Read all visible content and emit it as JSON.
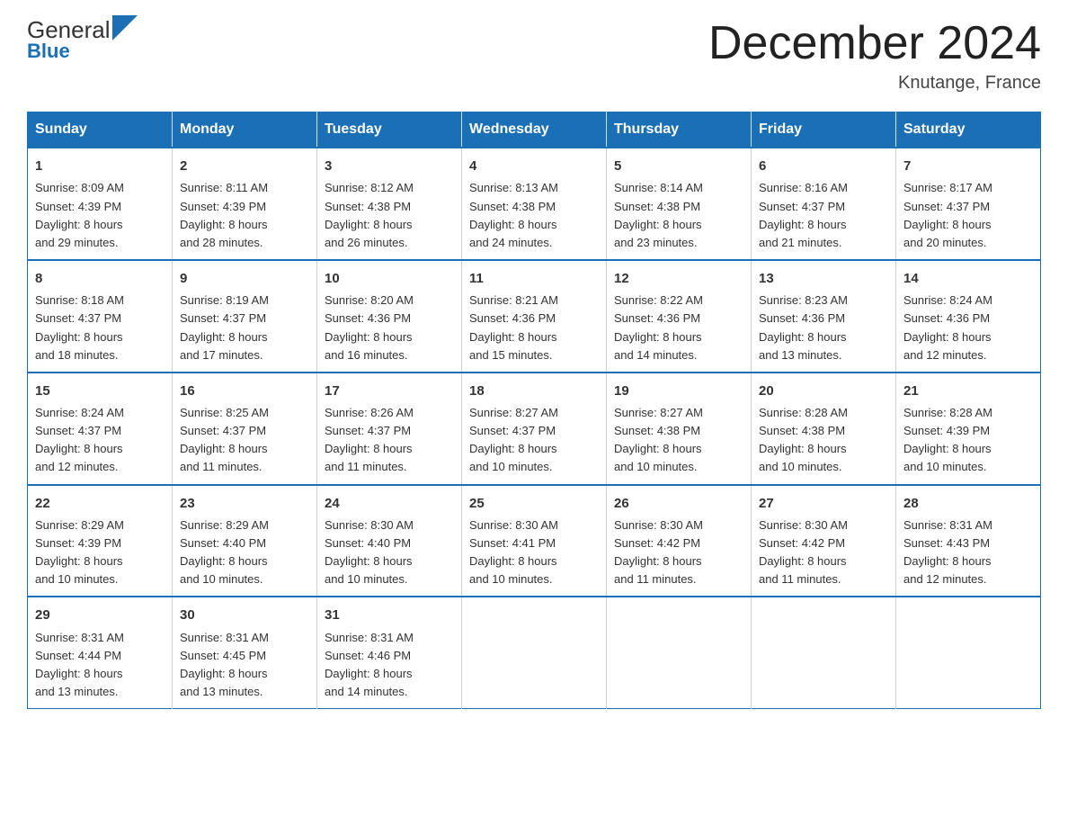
{
  "header": {
    "logo_general": "General",
    "logo_blue": "Blue",
    "month_title": "December 2024",
    "location": "Knutange, France"
  },
  "weekdays": [
    "Sunday",
    "Monday",
    "Tuesday",
    "Wednesday",
    "Thursday",
    "Friday",
    "Saturday"
  ],
  "weeks": [
    [
      {
        "day": "1",
        "sunrise": "8:09 AM",
        "sunset": "4:39 PM",
        "daylight": "8 hours and 29 minutes."
      },
      {
        "day": "2",
        "sunrise": "8:11 AM",
        "sunset": "4:39 PM",
        "daylight": "8 hours and 28 minutes."
      },
      {
        "day": "3",
        "sunrise": "8:12 AM",
        "sunset": "4:38 PM",
        "daylight": "8 hours and 26 minutes."
      },
      {
        "day": "4",
        "sunrise": "8:13 AM",
        "sunset": "4:38 PM",
        "daylight": "8 hours and 24 minutes."
      },
      {
        "day": "5",
        "sunrise": "8:14 AM",
        "sunset": "4:38 PM",
        "daylight": "8 hours and 23 minutes."
      },
      {
        "day": "6",
        "sunrise": "8:16 AM",
        "sunset": "4:37 PM",
        "daylight": "8 hours and 21 minutes."
      },
      {
        "day": "7",
        "sunrise": "8:17 AM",
        "sunset": "4:37 PM",
        "daylight": "8 hours and 20 minutes."
      }
    ],
    [
      {
        "day": "8",
        "sunrise": "8:18 AM",
        "sunset": "4:37 PM",
        "daylight": "8 hours and 18 minutes."
      },
      {
        "day": "9",
        "sunrise": "8:19 AM",
        "sunset": "4:37 PM",
        "daylight": "8 hours and 17 minutes."
      },
      {
        "day": "10",
        "sunrise": "8:20 AM",
        "sunset": "4:36 PM",
        "daylight": "8 hours and 16 minutes."
      },
      {
        "day": "11",
        "sunrise": "8:21 AM",
        "sunset": "4:36 PM",
        "daylight": "8 hours and 15 minutes."
      },
      {
        "day": "12",
        "sunrise": "8:22 AM",
        "sunset": "4:36 PM",
        "daylight": "8 hours and 14 minutes."
      },
      {
        "day": "13",
        "sunrise": "8:23 AM",
        "sunset": "4:36 PM",
        "daylight": "8 hours and 13 minutes."
      },
      {
        "day": "14",
        "sunrise": "8:24 AM",
        "sunset": "4:36 PM",
        "daylight": "8 hours and 12 minutes."
      }
    ],
    [
      {
        "day": "15",
        "sunrise": "8:24 AM",
        "sunset": "4:37 PM",
        "daylight": "8 hours and 12 minutes."
      },
      {
        "day": "16",
        "sunrise": "8:25 AM",
        "sunset": "4:37 PM",
        "daylight": "8 hours and 11 minutes."
      },
      {
        "day": "17",
        "sunrise": "8:26 AM",
        "sunset": "4:37 PM",
        "daylight": "8 hours and 11 minutes."
      },
      {
        "day": "18",
        "sunrise": "8:27 AM",
        "sunset": "4:37 PM",
        "daylight": "8 hours and 10 minutes."
      },
      {
        "day": "19",
        "sunrise": "8:27 AM",
        "sunset": "4:38 PM",
        "daylight": "8 hours and 10 minutes."
      },
      {
        "day": "20",
        "sunrise": "8:28 AM",
        "sunset": "4:38 PM",
        "daylight": "8 hours and 10 minutes."
      },
      {
        "day": "21",
        "sunrise": "8:28 AM",
        "sunset": "4:39 PM",
        "daylight": "8 hours and 10 minutes."
      }
    ],
    [
      {
        "day": "22",
        "sunrise": "8:29 AM",
        "sunset": "4:39 PM",
        "daylight": "8 hours and 10 minutes."
      },
      {
        "day": "23",
        "sunrise": "8:29 AM",
        "sunset": "4:40 PM",
        "daylight": "8 hours and 10 minutes."
      },
      {
        "day": "24",
        "sunrise": "8:30 AM",
        "sunset": "4:40 PM",
        "daylight": "8 hours and 10 minutes."
      },
      {
        "day": "25",
        "sunrise": "8:30 AM",
        "sunset": "4:41 PM",
        "daylight": "8 hours and 10 minutes."
      },
      {
        "day": "26",
        "sunrise": "8:30 AM",
        "sunset": "4:42 PM",
        "daylight": "8 hours and 11 minutes."
      },
      {
        "day": "27",
        "sunrise": "8:30 AM",
        "sunset": "4:42 PM",
        "daylight": "8 hours and 11 minutes."
      },
      {
        "day": "28",
        "sunrise": "8:31 AM",
        "sunset": "4:43 PM",
        "daylight": "8 hours and 12 minutes."
      }
    ],
    [
      {
        "day": "29",
        "sunrise": "8:31 AM",
        "sunset": "4:44 PM",
        "daylight": "8 hours and 13 minutes."
      },
      {
        "day": "30",
        "sunrise": "8:31 AM",
        "sunset": "4:45 PM",
        "daylight": "8 hours and 13 minutes."
      },
      {
        "day": "31",
        "sunrise": "8:31 AM",
        "sunset": "4:46 PM",
        "daylight": "8 hours and 14 minutes."
      },
      null,
      null,
      null,
      null
    ]
  ],
  "labels": {
    "sunrise_prefix": "Sunrise: ",
    "sunset_prefix": "Sunset: ",
    "daylight_prefix": "Daylight: "
  }
}
